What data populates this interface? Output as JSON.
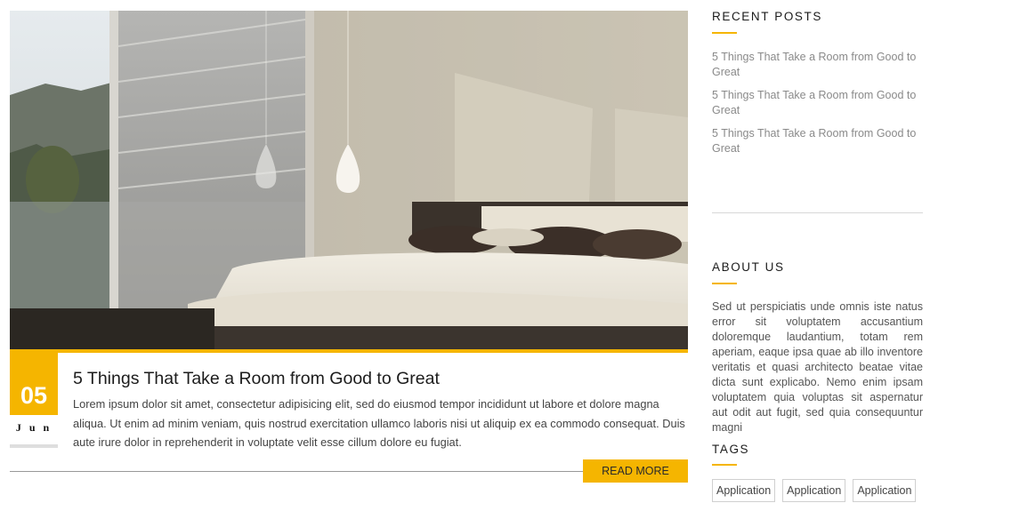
{
  "post": {
    "day": "05",
    "month": "Jun",
    "title": "5 Things That Take a Room from Good to Great",
    "excerpt": "Lorem ipsum dolor sit amet, consectetur adipisicing elit, sed do eiusmod tempor incididunt ut labore et dolore magna aliqua. Ut enim ad minim veniam, quis nostrud exercitation ullamco laboris nisi ut aliquip ex ea commodo consequat. Duis aute irure dolor in reprehenderit in voluptate velit esse cillum dolore eu fugiat.",
    "read_more_label": "READ MORE"
  },
  "sidebar": {
    "recent_posts": {
      "title": "RECENT POSTS",
      "items": [
        {
          "label": "5 Things That Take a Room from Good to Great"
        },
        {
          "label": "5 Things That Take a Room from Good to Great"
        },
        {
          "label": "5 Things That Take a Room from Good to Great"
        }
      ]
    },
    "about": {
      "title": "ABOUT US",
      "text": "Sed ut perspiciatis unde omnis iste natus error sit voluptatem accusantium doloremque laudantium, totam rem aperiam, eaque ipsa quae ab illo inventore veritatis et quasi architecto beatae vitae dicta sunt explicabo. Nemo enim ipsam voluptatem quia voluptas sit aspernatur aut odit aut fugit, sed quia consequuntur magni"
    },
    "tags": {
      "title": "TAGS",
      "items": [
        {
          "label": "Application"
        },
        {
          "label": "Application"
        },
        {
          "label": "Application"
        }
      ]
    }
  },
  "colors": {
    "accent": "#f5b500",
    "title_text": "#1c1c1c",
    "muted_text": "#8a8a8a"
  }
}
